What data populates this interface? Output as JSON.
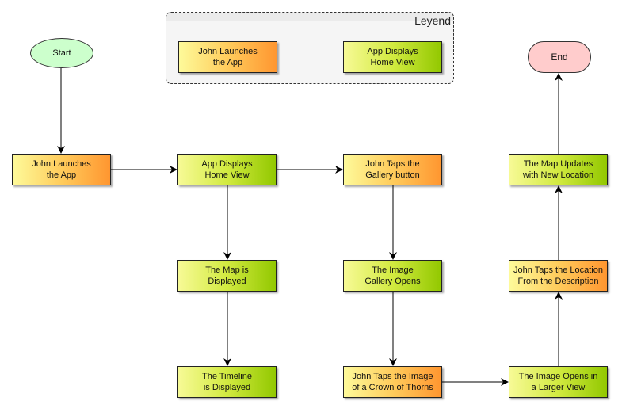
{
  "legend": {
    "title": "Leyend",
    "items": [
      {
        "label": "John Launches\nthe App",
        "kind": "action"
      },
      {
        "label": "App Displays\nHome View",
        "kind": "system"
      }
    ]
  },
  "terminals": {
    "start": "Start",
    "end": "End"
  },
  "nodes": [
    {
      "id": "launch",
      "label": "John Launches\nthe App",
      "kind": "action"
    },
    {
      "id": "home",
      "label": "App Displays\nHome View",
      "kind": "system"
    },
    {
      "id": "tap-gallery",
      "label": "John Taps the\nGallery button",
      "kind": "action"
    },
    {
      "id": "map-updates",
      "label": "The Map Updates\nwith New Location",
      "kind": "system"
    },
    {
      "id": "map-displayed",
      "label": "The Map is\nDisplayed",
      "kind": "system"
    },
    {
      "id": "gallery-opens",
      "label": "The Image\nGallery Opens",
      "kind": "system"
    },
    {
      "id": "tap-location",
      "label": "John Taps the Location\nFrom the Description",
      "kind": "action"
    },
    {
      "id": "timeline",
      "label": "The Timeline\nis Displayed",
      "kind": "system"
    },
    {
      "id": "tap-image",
      "label": "John Taps the Image\nof a Crown of Thorns",
      "kind": "action"
    },
    {
      "id": "image-larger",
      "label": "The Image Opens in\na Larger View",
      "kind": "system"
    }
  ],
  "edges": [
    {
      "from": "start",
      "to": "launch"
    },
    {
      "from": "launch",
      "to": "home"
    },
    {
      "from": "home",
      "to": "tap-gallery"
    },
    {
      "from": "home",
      "to": "map-displayed"
    },
    {
      "from": "map-displayed",
      "to": "timeline"
    },
    {
      "from": "tap-gallery",
      "to": "gallery-opens"
    },
    {
      "from": "gallery-opens",
      "to": "tap-image"
    },
    {
      "from": "tap-image",
      "to": "image-larger"
    },
    {
      "from": "image-larger",
      "to": "tap-location"
    },
    {
      "from": "tap-location",
      "to": "map-updates"
    },
    {
      "from": "map-updates",
      "to": "end"
    }
  ],
  "colors": {
    "action_start": "#fefa9a",
    "action_end": "#ff9630",
    "system_start": "#f7fa96",
    "system_end": "#92c800",
    "start_fill": "#ccffcc",
    "end_fill": "#ffcccc"
  }
}
